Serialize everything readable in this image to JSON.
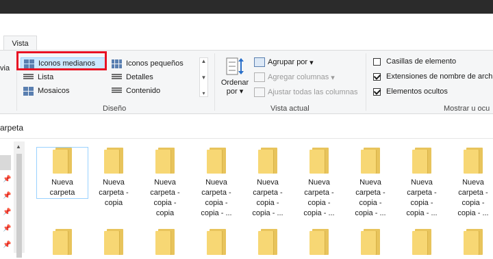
{
  "ribbon": {
    "tab_vista": "Vista",
    "panes_partial": "via",
    "layout": {
      "items": {
        "iconos_medianos": "Iconos medianos",
        "iconos_pequenos": "Iconos pequeños",
        "lista": "Lista",
        "detalles": "Detalles",
        "mosaicos": "Mosaicos",
        "contenido": "Contenido"
      },
      "group_label": "Diseño"
    },
    "current_view": {
      "ordenar_line1": "Ordenar",
      "ordenar_line2": "por",
      "ordenar_arrow": "▾",
      "agrupar": "Agrupar por",
      "agrupar_arrow": "▾",
      "agregar_columnas": "Agregar columnas",
      "agregar_arrow": "▾",
      "ajustar_columnas": "Ajustar todas las columnas",
      "group_label": "Vista actual"
    },
    "show_hide": {
      "casillas": "Casillas de elemento",
      "casillas_checked": false,
      "extensiones": "Extensiones de nombre de arch",
      "extensiones_checked": true,
      "ocultos": "Elementos ocultos",
      "ocultos_checked": true,
      "group_label": "Mostrar u ocu"
    }
  },
  "address": {
    "path": "arpeta"
  },
  "files": {
    "row1": [
      {
        "lines": [
          "Nueva",
          "carpeta"
        ]
      },
      {
        "lines": [
          "Nueva",
          "carpeta -",
          "copia"
        ]
      },
      {
        "lines": [
          "Nueva",
          "carpeta -",
          "copia -",
          "copia"
        ]
      },
      {
        "lines": [
          "Nueva",
          "carpeta -",
          "copia -",
          "copia - ..."
        ]
      },
      {
        "lines": [
          "Nueva",
          "carpeta -",
          "copia -",
          "copia - ..."
        ]
      },
      {
        "lines": [
          "Nueva",
          "carpeta -",
          "copia -",
          "copia - ..."
        ]
      },
      {
        "lines": [
          "Nueva",
          "carpeta -",
          "copia -",
          "copia - ..."
        ]
      },
      {
        "lines": [
          "Nueva",
          "carpeta -",
          "copia -",
          "copia - ..."
        ]
      },
      {
        "lines": [
          "Nueva",
          "carpeta -",
          "copia -",
          "copia - ..."
        ]
      }
    ]
  },
  "colors": {
    "accent_selection": "#cce8ff",
    "highlight_box": "#e81123",
    "folder": "#f7d774"
  }
}
